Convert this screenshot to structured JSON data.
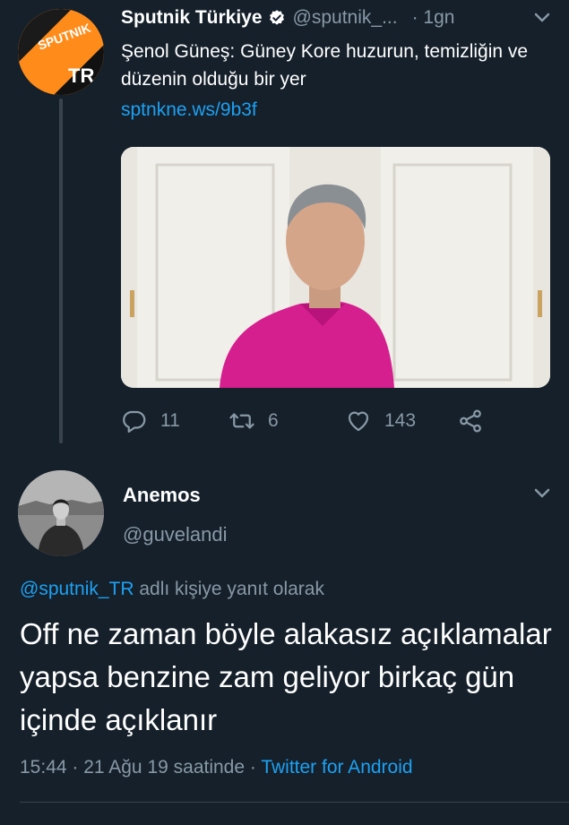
{
  "tweet1": {
    "avatar_text_top": "SPUTNIK",
    "avatar_text_bottom": "TR",
    "name": "Sputnik Türkiye",
    "handle": "@sputnik_...",
    "time": "· 1gn",
    "text": "Şenol Güneş: Güney Kore huzurun, temizliğin ve düzenin olduğu bir yer",
    "link": "sptnkne.ws/9b3f",
    "counts": {
      "reply": "11",
      "retweet": "6",
      "like": "143"
    }
  },
  "tweet2": {
    "name": "Anemos",
    "handle": "@guvelandi",
    "reply_mention": "@sputnik_TR",
    "reply_suffix": " adlı kişiye yanıt olarak",
    "text": "Off ne zaman böyle alakasız açıklamalar yapsa benzine zam geliyor birkaç gün içinde açıklanır",
    "timestamp": "15:44 · 21 Ağu 19 saatinde · ",
    "source": "Twitter for Android"
  },
  "icons": {
    "verified": "verified-badge-icon",
    "chevron": "chevron-down-icon",
    "reply": "reply-icon",
    "retweet": "retweet-icon",
    "like": "heart-icon",
    "share": "share-icon"
  },
  "colors": {
    "background": "#15202b",
    "text_primary": "#ffffff",
    "text_secondary": "#8899a6",
    "accent": "#1da1f2",
    "sputnik_orange": "#ff8c1a",
    "divider": "#38444d"
  }
}
